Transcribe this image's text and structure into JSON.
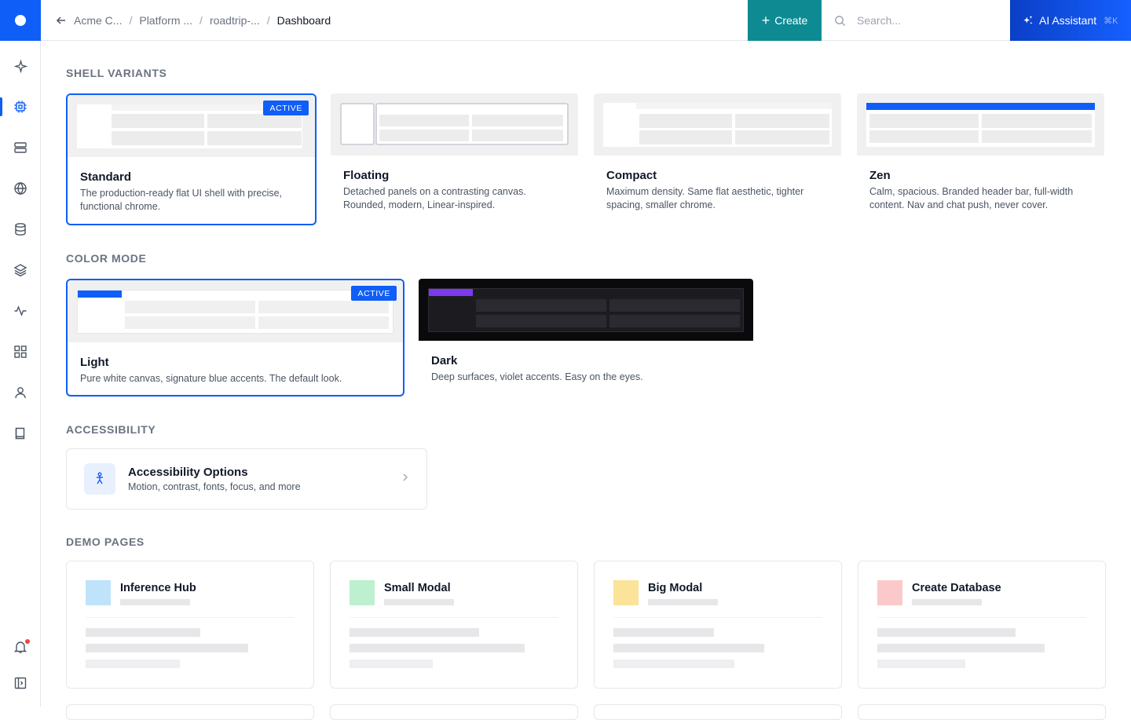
{
  "topbar": {
    "breadcrumbs": [
      "Acme C...",
      "Platform ...",
      "roadtrip-...",
      "Dashboard"
    ],
    "separator": "/",
    "create_label": "Create",
    "search_placeholder": "Search...",
    "ai_label": "AI Assistant",
    "ai_shortcut": "⌘K"
  },
  "sidebar": {
    "items": [
      "sparkle-icon",
      "chip-icon",
      "servers-icon",
      "globe-icon",
      "database-icon",
      "layers-icon",
      "activity-icon",
      "grid-icon",
      "user-icon",
      "book-icon"
    ],
    "bottom": [
      "bell-icon",
      "panel-toggle-icon"
    ],
    "active": "chip-icon"
  },
  "sections": {
    "shell": "SHELL VARIANTS",
    "color": "COLOR MODE",
    "accessibility": "ACCESSIBILITY",
    "demo": "DEMO PAGES"
  },
  "shell_variants": [
    {
      "name": "Standard",
      "desc": "The production-ready flat UI shell with precise, functional chrome.",
      "badge": "ACTIVE"
    },
    {
      "name": "Floating",
      "desc": "Detached panels on a contrasting canvas. Rounded, modern, Linear-inspired."
    },
    {
      "name": "Compact",
      "desc": "Maximum density. Same flat aesthetic, tighter spacing, smaller chrome."
    },
    {
      "name": "Zen",
      "desc": "Calm, spacious. Branded header bar, full-width content. Nav and chat push, never cover."
    }
  ],
  "color_modes": [
    {
      "name": "Light",
      "desc": "Pure white canvas, signature blue accents. The default look.",
      "badge": "ACTIVE"
    },
    {
      "name": "Dark",
      "desc": "Deep surfaces, violet accents. Easy on the eyes."
    }
  ],
  "accessibility": {
    "title": "Accessibility Options",
    "subtitle": "Motion, contrast, fonts, focus, and more"
  },
  "demo_pages": [
    {
      "name": "Inference Hub",
      "color": "#bfe3fb"
    },
    {
      "name": "Small Modal",
      "color": "#bdf0cf"
    },
    {
      "name": "Big Modal",
      "color": "#fbe39a"
    },
    {
      "name": "Create Database",
      "color": "#fbc9c9"
    }
  ],
  "colors": {
    "accent": "#0f5ef7",
    "create": "#0e8a93",
    "dark_accent": "#7c3aed"
  }
}
